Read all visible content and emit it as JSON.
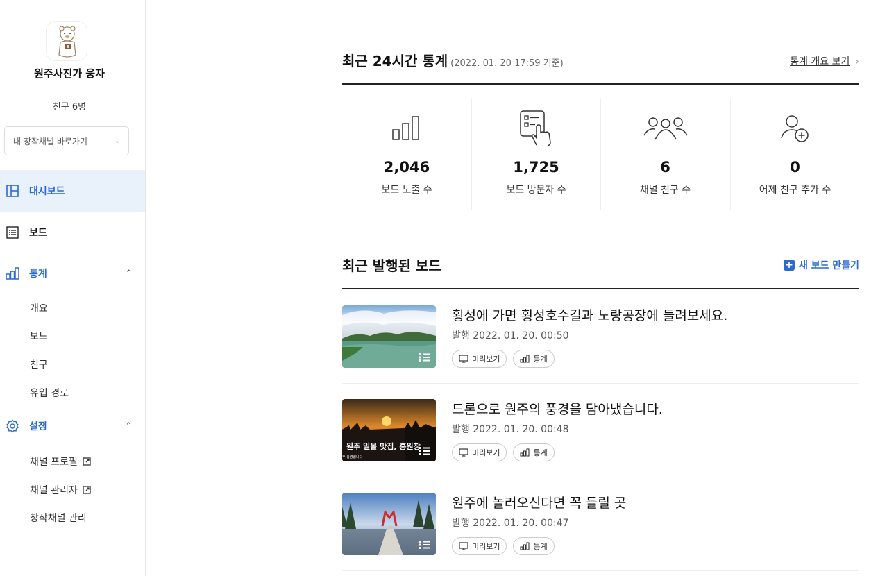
{
  "profile": {
    "channel_name": "원주사진가 웅자",
    "friends": "친구 6명",
    "channel_select": "내 창작채널 바로가기"
  },
  "nav": {
    "dashboard": "대시보드",
    "board": "보드",
    "stats": "통계",
    "stats_sub": [
      "개요",
      "보드",
      "친구",
      "유입 경로"
    ],
    "settings": "설정",
    "settings_sub": [
      "채널 프로필",
      "채널 관리자",
      "창작채널 관리"
    ]
  },
  "stats": {
    "title": "최근 24시간 통계",
    "subtitle": "(2022. 01. 20 17:59 기준)",
    "overview_link": "통계 개요 보기",
    "items": [
      {
        "value": "2,046",
        "label": "보드 노출 수",
        "icon": "bar-chart-icon"
      },
      {
        "value": "1,725",
        "label": "보드 방문자 수",
        "icon": "click-board-icon"
      },
      {
        "value": "6",
        "label": "채널 친구 수",
        "icon": "group-icon"
      },
      {
        "value": "0",
        "label": "어제 친구 추가 수",
        "icon": "add-person-icon"
      }
    ]
  },
  "boards": {
    "title": "최근 발행된 보드",
    "new_board": "새 보드 만들기",
    "preview_label": "미리보기",
    "stats_label": "통계",
    "items": [
      {
        "title": "횡성에 가면 횡성호수길과 노랑공장에 들려보세요.",
        "date": "발행 2022. 01. 20. 00:50"
      },
      {
        "title": "드론으로 원주의 풍경을 담아냈습니다.",
        "date": "발행 2022. 01. 20. 00:48",
        "thumb_text": "원주 일몰 맛집, 흥원창",
        "thumb_small_text": "주 풍경입니다"
      },
      {
        "title": "원주에 놀러오신다면 꼭 들릴 곳",
        "date": "발행 2022. 01. 20. 00:47"
      }
    ]
  }
}
